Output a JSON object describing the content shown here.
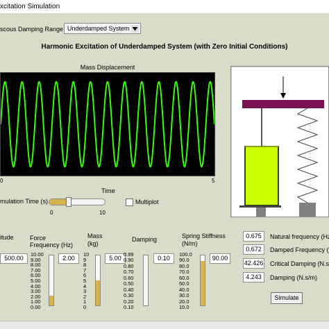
{
  "window": {
    "title": "xcitation Simulation"
  },
  "damping_range": {
    "label": "scous Damping Range",
    "value": "Underdamped System"
  },
  "heading": "Harmonic Excitation of Underdamped System (with Zero Initial Conditions)",
  "graph": {
    "title": "Mass Displacement",
    "x_axis_label": "Time",
    "x_ticks": [
      "0",
      "5"
    ]
  },
  "chart_data": {
    "type": "line",
    "title": "Mass Displacement",
    "xlabel": "Time",
    "ylabel": "",
    "xlim": [
      0,
      5
    ],
    "cycles": 12.5,
    "amplitude": 0.9,
    "grid": false,
    "line_color": "#33ff00",
    "background": "#000000"
  },
  "sim_time": {
    "label": "mulation Time (s)",
    "min": "0",
    "max": "10",
    "fill_fraction": 0.35
  },
  "multiplot": {
    "label": "Multiplot",
    "checked": false
  },
  "controls": [
    {
      "label": "itude",
      "value": "500.00"
    },
    {
      "label": "Force Frequency (Hz)",
      "value": "2.00",
      "ticks": [
        "10.00",
        "9.00",
        "8.00",
        "7.00",
        "6.00",
        "5.00",
        "4.00",
        "3.00",
        "2.00",
        "1.00",
        "0.00"
      ],
      "level": 0.2
    },
    {
      "label": "Mass (kg)",
      "value": "5.00",
      "ticks": [
        "10",
        "9",
        "8",
        "7",
        "6",
        "5",
        "4",
        "3",
        "2",
        "1",
        "0"
      ],
      "level": 0.5
    },
    {
      "label": "Damping",
      "value": "0.10",
      "ticks": [
        "0.99",
        "0.90",
        "0.80",
        "0.70",
        "0.60",
        "0.50",
        "0.40",
        "0.30",
        "0.20",
        "0.10"
      ],
      "level": 0.0
    },
    {
      "label": "Spring Stiffness (N/m)",
      "value": "90.00",
      "ticks": [
        "100.0",
        "90.0",
        "80.0",
        "70.0",
        "60.0",
        "50.0",
        "40.0",
        "30.0",
        "20.0",
        "10.0"
      ],
      "level": 0.89
    }
  ],
  "outputs": [
    {
      "value": "0.675",
      "label": "Natural frequency (Hz)"
    },
    {
      "value": "0.672",
      "label": "Damped Frequency (Hz)"
    },
    {
      "value": "42.426",
      "label": "Critical Damping (N.s/m)"
    },
    {
      "value": "4.243",
      "label": "Damping (N.s/m)"
    }
  ],
  "simulate_button": "Simulate",
  "colors": {
    "panel": "#d9dcc9",
    "beam": "#7a1150",
    "fluid": "#ccff00",
    "slider_fill": "#d8b24a"
  }
}
